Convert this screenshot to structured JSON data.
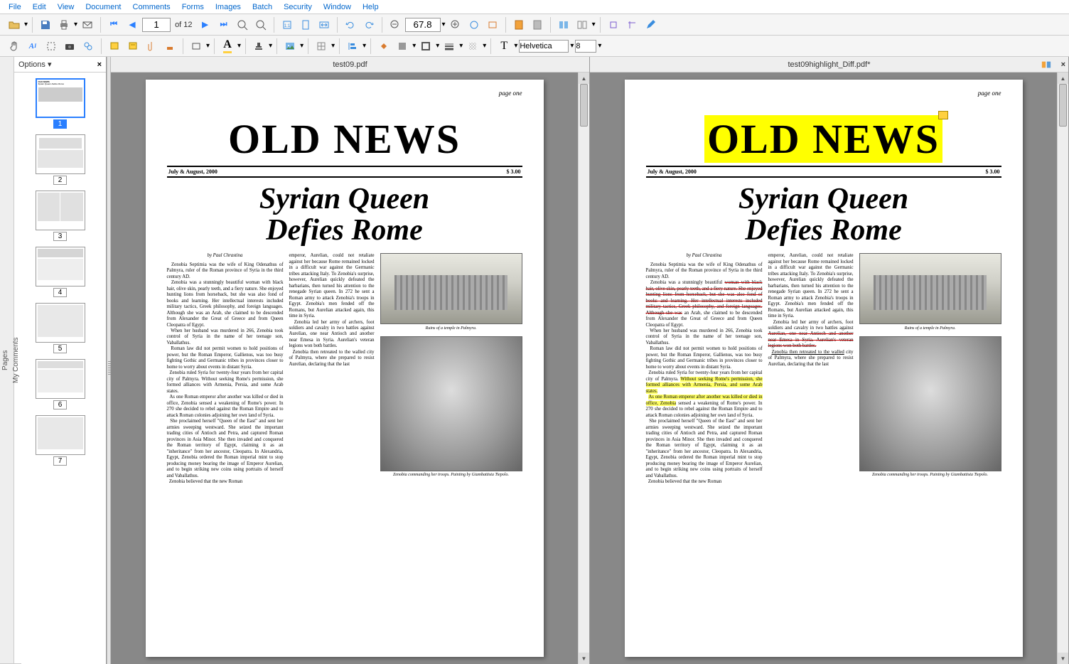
{
  "menu": [
    "File",
    "Edit",
    "View",
    "Document",
    "Comments",
    "Forms",
    "Images",
    "Batch",
    "Security",
    "Window",
    "Help"
  ],
  "toolbar": {
    "page_current": "1",
    "page_total": "of 12",
    "zoom": "67.8",
    "font": "Helvetica",
    "fontsize": "8"
  },
  "thumbpanel": {
    "options": "Options ▾",
    "close": "×",
    "pages": [
      "1",
      "2",
      "3",
      "4",
      "5",
      "6",
      "7"
    ]
  },
  "docs": {
    "left": {
      "title": "test09.pdf"
    },
    "right": {
      "title": "test09highlight_Diff.pdf*"
    }
  },
  "article": {
    "pagenum": "page one",
    "masthead": "OLD NEWS",
    "date": "July & August, 2000",
    "price": "$ 3.00",
    "headline1": "Syrian Queen",
    "headline2": "Defies Rome",
    "byline": "by Paul Chrastina",
    "col1_p1": "Zenobia Septimia was the wife of King Odenathus of Palmyra, ruler of the Roman province of Syria in the third century AD.",
    "col1_p2a": "Zenobia was a stunningly beautiful ",
    "col1_p2_s": "woman with black hair, olive skin, pearly teeth, and a fiery nature. She enjoyed hunting lions from horseback, but she was also fond of books and learning. Her intellectual interests included military tactics, Greek philosophy, and foreign languages. Although she was",
    "col1_p2b": " an Arab, she claimed to be descended from Alexander the Great of Greece and from Queen Cleopatra of Egypt.",
    "col1_p3": "When her husband was murdered in 266, Zenobia took control of Syria in the name of her teenage son, Vaballathus.",
    "col1_p4": "Roman law did not permit women to hold positions of power, but the Roman Emperor, Gallienus, was too busy fighting Gothic and Germanic tribes in provinces closer to home to worry about events in distant Syria.",
    "col1_p5a": "Zenobia ruled Syria for twenty-four years from her capital city of Palmyra. ",
    "col1_p5_h": "Without seeking Rome's permission, she formed alliances with Armenia, Persia, and some Arab states.",
    "col1_p6_h": "As one Roman emperor after another was killed or died in office, Zenobia",
    "col1_p6b": " sensed a weakening of Rome's power. In 270 she decided to rebel against the Roman Empire and to attack Roman colonies adjoining her own land of Syria.",
    "col1_p7": "She proclaimed herself \"Queen of the East\" and sent her armies sweeping westward. She seized the important trading cities of Antioch and Petra, and captured Roman provinces in Asia Minor. She then invaded and conquered the Roman territory of Egypt, claiming it as an \"inheritance\" from her ancestor, Cleopatra. In Alexandria, Egypt, Zenobia ordered the Roman imperial mint to stop producing money bearing the image of Emperor Aurelian, and to begin striking new coins using portraits of herself and Vaballathus.",
    "col1_p8": "Zenobia believed that the new Roman",
    "col2_p1": "emperor, Aurelian, could not retaliate against her because Rome remained locked in a difficult war against the Germanic tribes attacking Italy. To Zenobia's surprise, however, Aurelian quickly defeated the barbarians, then turned his attention to the renegade Syrian queen. In 272 he sent a Roman army to attack Zenobia's troops in Egypt. Zenobia's men fended off the Romans, but Aurelian attacked again, this time in Syria.",
    "col2_p2a": "Zenobia led her army of archers, foot soldiers and cavalry in two battles against ",
    "col2_p2_s": "Aurelian, one near Antioch and another near Emesa in Syria. Aurelian's veteran legions won both battles.",
    "col2_p3a": "Zenobia then retreated to the walled",
    "col2_p3b": " city of Palmyra, where she prepared to resist Aurelian, declaring that the last",
    "caption1": "Ruins of a temple in Palmyra.",
    "caption2": "Zenobia commanding her troops. Painting by Giambattista Tiepolo."
  },
  "leftrail": {
    "pages": "Pages",
    "comments": "My Comments"
  }
}
